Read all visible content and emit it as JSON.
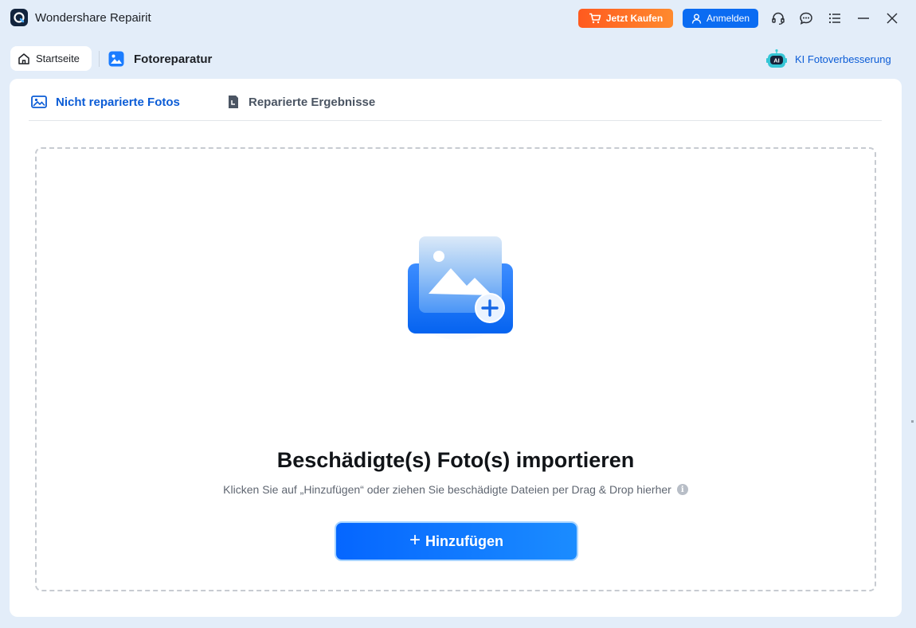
{
  "app": {
    "title": "Wondershare Repairit"
  },
  "header": {
    "buy_label": "Jetzt Kaufen",
    "login_label": "Anmelden"
  },
  "tabs": {
    "home_label": "Startseite",
    "photo_repair_label": "Fotoreparatur",
    "ai_enhance_label": "KI Fotoverbesserung",
    "ai_badge": "AI"
  },
  "subtabs": [
    {
      "label": "Nicht reparierte Fotos",
      "active": true
    },
    {
      "label": "Reparierte Ergebnisse",
      "active": false
    }
  ],
  "dropzone": {
    "title": "Beschädigte(s) Foto(s) importieren",
    "hint": "Klicken Sie auf „Hinzufügen“ oder ziehen Sie beschädigte Dateien per Drag & Drop hierher",
    "info_glyph": "i",
    "add_label": "Hinzufügen",
    "add_plus": "+"
  },
  "colors": {
    "accent": "#0b6cf2",
    "buy": "#ff6a22",
    "background": "#e3edf9"
  },
  "icons": [
    "app-logo-icon",
    "cart-icon",
    "user-icon",
    "headset-icon",
    "chat-icon",
    "menu-icon",
    "minimize-icon",
    "close-icon",
    "home-icon",
    "photo-icon",
    "ai-robot-icon",
    "image-icon",
    "document-icon",
    "info-icon",
    "add-photo-icon"
  ]
}
